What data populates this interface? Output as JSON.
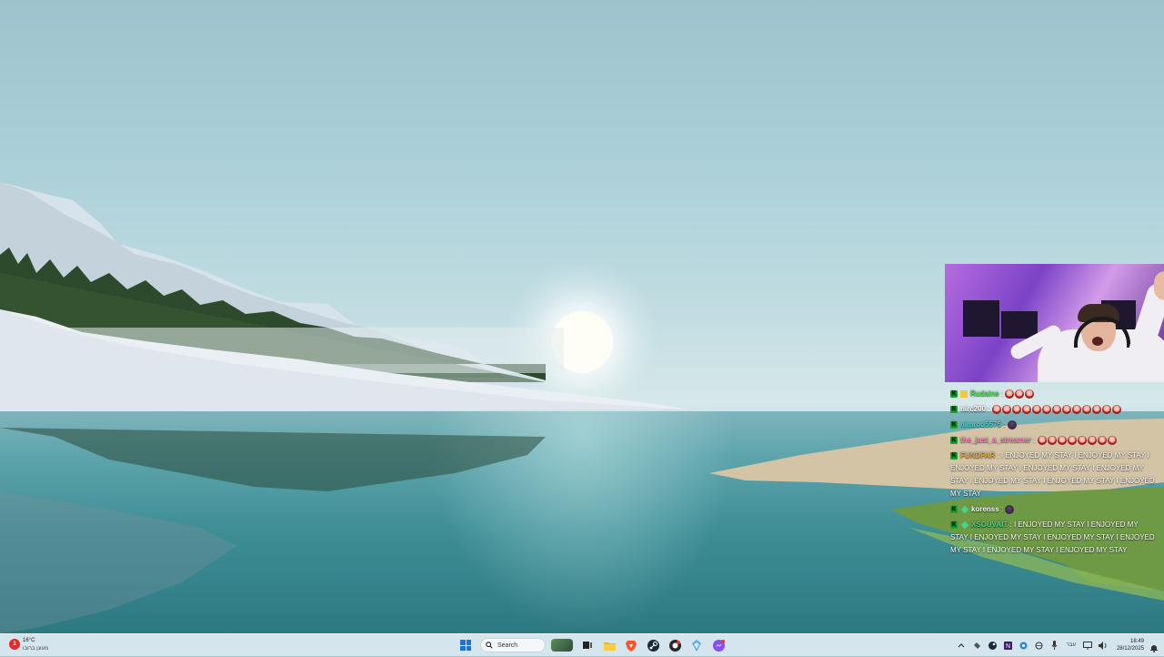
{
  "taskbar": {
    "weather": {
      "temperature": "16°C",
      "description": "מעונן ברובו",
      "badge": "1"
    },
    "search_placeholder": "Search",
    "language": "עבר",
    "clock": {
      "time": "18:49",
      "date": "28/12/2025"
    },
    "pinned_icons": [
      "news-widget-icon",
      "task-view-icon",
      "file-explorer-icon",
      "brave-browser-icon",
      "steam-icon",
      "obs-studio-icon",
      "app-icon",
      "messenger-icon"
    ],
    "tray_icons": [
      "show-hidden-icons-chevron",
      "tray-app-icon",
      "steam-tray-icon",
      "notion-icon",
      "tray-app-icon",
      "wifi-icon",
      "microphone-icon",
      "monitor-icon",
      "volume-icon",
      "notification-bell-icon"
    ]
  },
  "overlay": {
    "webcam_label": "streamer-webcam",
    "chat": [
      {
        "user": "Rudaine",
        "color": "#46e04a",
        "text": "",
        "emotes": 3,
        "badges": [
          "k",
          "gift"
        ]
      },
      {
        "user": "nirc200",
        "color": "#ffffff",
        "text": "",
        "emotes": 13,
        "badges": [
          "k"
        ]
      },
      {
        "user": "nimrod5575",
        "color": "#46e0d0",
        "text": "",
        "emotes": 1,
        "badges": [
          "k"
        ]
      },
      {
        "user": "the_just_a_streamer",
        "color": "#ff7ac8",
        "text": "",
        "emotes": 8,
        "badges": [
          "k"
        ]
      },
      {
        "user": "FUNDFAR",
        "color": "#e8a23a",
        "text": "I ENJOYED MY STAY I ENJOYED MY STAY I ENJOYED MY STAY I ENJOYED MY STAY I ENJOYED MY STAY I ENJOYED MY STAY I ENJOYED MY STAY I ENJOYED MY STAY",
        "emotes": 0,
        "badges": [
          "k"
        ]
      },
      {
        "user": "korenss",
        "color": "#ffffff",
        "text": "",
        "emotes": 1,
        "badges": [
          "k",
          "diamond"
        ]
      },
      {
        "user": "XSOUVAIT",
        "color": "#48d48a",
        "text": "I ENJOYED MY STAY I ENJOYED MY STAY I ENJOYED MY STAY I ENJOYED MY STAY I ENJOYED MY STAY I ENJOYED MY STAY I ENJOYED MY STAY",
        "emotes": 0,
        "badges": [
          "k",
          "diamond"
        ]
      }
    ]
  },
  "colors": {
    "taskbar": "#d6e6ee",
    "accent": "#1a73d9",
    "badge_green": "#1ea332"
  }
}
